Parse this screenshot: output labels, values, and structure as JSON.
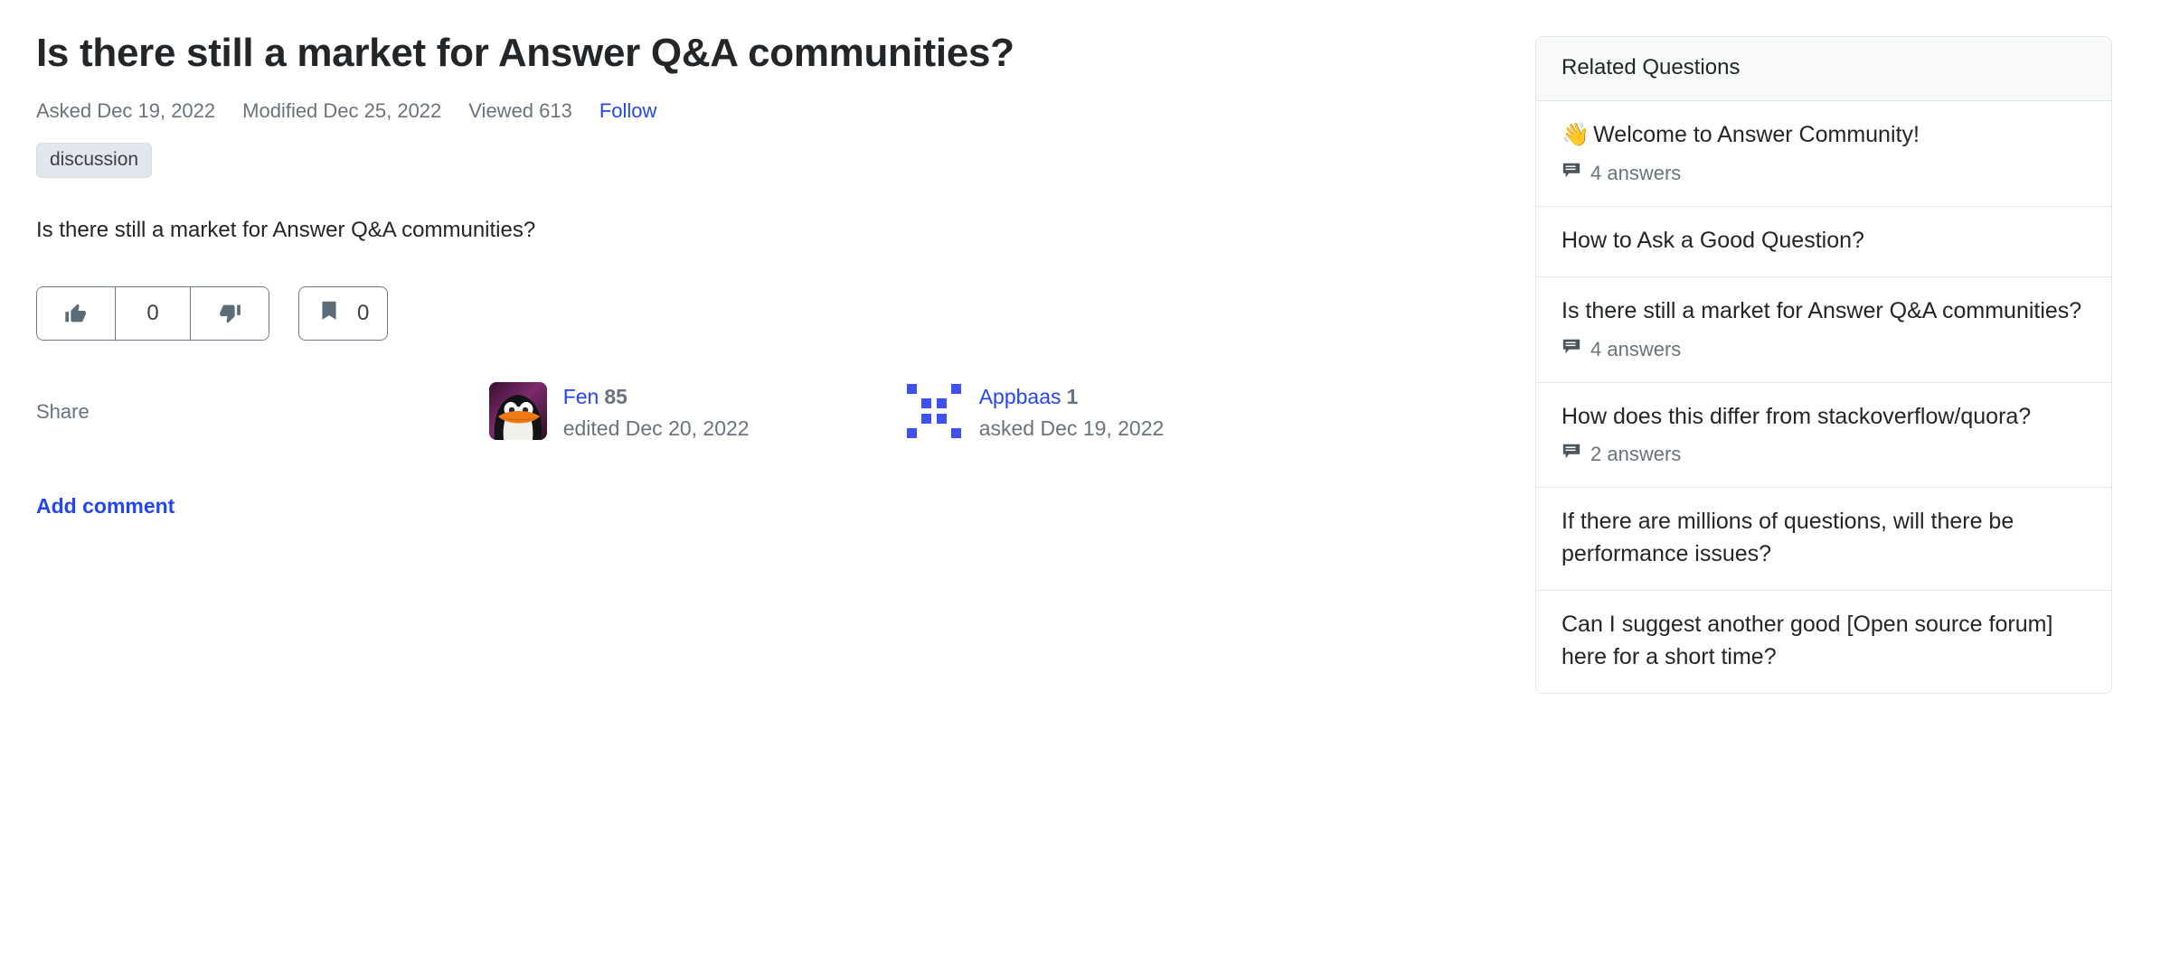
{
  "question": {
    "title": "Is there still a market for Answer Q&A communities?",
    "meta": {
      "asked": "Asked Dec 19, 2022",
      "modified": "Modified Dec 25, 2022",
      "viewed": "Viewed 613",
      "follow_label": "Follow"
    },
    "tags": [
      "discussion"
    ],
    "body": "Is there still a market for Answer Q&A communities?",
    "vote_count": "0",
    "bookmark_count": "0",
    "share_label": "Share",
    "add_comment_label": "Add comment",
    "icons": {
      "upvote": "thumbs-up-icon",
      "downvote": "thumbs-down-icon",
      "bookmark": "bookmark-icon"
    }
  },
  "contributors": [
    {
      "avatar": "penguin-avatar",
      "name": "Fen",
      "reputation": "85",
      "action": "edited Dec 20, 2022"
    },
    {
      "avatar": "identicon-avatar",
      "name": "Appbaas",
      "reputation": "1",
      "action": "asked Dec 19, 2022"
    }
  ],
  "sidebar": {
    "header": "Related Questions",
    "items": [
      {
        "emoji": "👋",
        "title": "Welcome to Answer Community!",
        "answers": "4 answers"
      },
      {
        "emoji": "",
        "title": "How to Ask a Good Question?",
        "answers": ""
      },
      {
        "emoji": "",
        "title": "Is there still a market for Answer Q&A communities?",
        "answers": "4 answers"
      },
      {
        "emoji": "",
        "title": "How does this differ from stackoverflow/quora?",
        "answers": "2 answers"
      },
      {
        "emoji": "",
        "title": "If there are millions of questions, will there be performance issues?",
        "answers": ""
      },
      {
        "emoji": "",
        "title": "Can I suggest another good [Open source forum] here for a short time?",
        "answers": ""
      }
    ]
  },
  "colors": {
    "link": "#2346f4",
    "muted": "#6a737c",
    "text": "#232629",
    "tag_bg": "#e1e7ec",
    "panel_border": "#e3e6e8",
    "panel_header_bg": "#f8f9f9",
    "identicon": "#3f51f3"
  }
}
